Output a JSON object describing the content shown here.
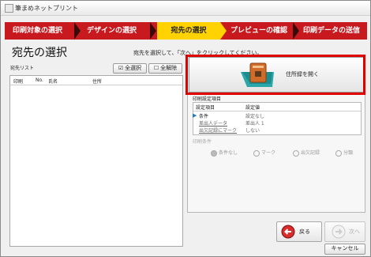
{
  "window": {
    "title": "筆まめネットプリント"
  },
  "steps": [
    {
      "label": "印刷対象の選択"
    },
    {
      "label": "デザインの選択"
    },
    {
      "label": "宛先の選択"
    },
    {
      "label": "プレビューの確認"
    },
    {
      "label": "印刷データの送信"
    }
  ],
  "page": {
    "title": "宛先の選択",
    "instruction": "宛先を選択して、「次へ」をクリックしてください。"
  },
  "address_list": {
    "label": "宛先リスト",
    "select_all_label": "全選択",
    "deselect_all_label": "全解除",
    "columns": [
      "印刷",
      "No.",
      "氏名",
      "住所"
    ]
  },
  "address_book_button": {
    "label": "住所録を開く"
  },
  "print_settings": {
    "title": "印刷設定項目",
    "columns": [
      "設定項目",
      "設定値"
    ],
    "rows": [
      {
        "item": "条件",
        "value": "設定なし"
      },
      {
        "item": "差出人データ",
        "value": "差出人 1"
      },
      {
        "item": "出欠記録にマーク",
        "value": "しない"
      }
    ]
  },
  "print_conditions": {
    "title": "印刷条件",
    "options": [
      "条件なし",
      "マーク",
      "出欠記録",
      "分類"
    ],
    "selected": "条件なし"
  },
  "nav": {
    "back_label": "戻る",
    "next_label": "次へ",
    "cancel_label": "キャンセル"
  },
  "colors": {
    "step_bar": "#c8191f",
    "step_active": "#ffd200",
    "highlight_border": "#e00000"
  }
}
